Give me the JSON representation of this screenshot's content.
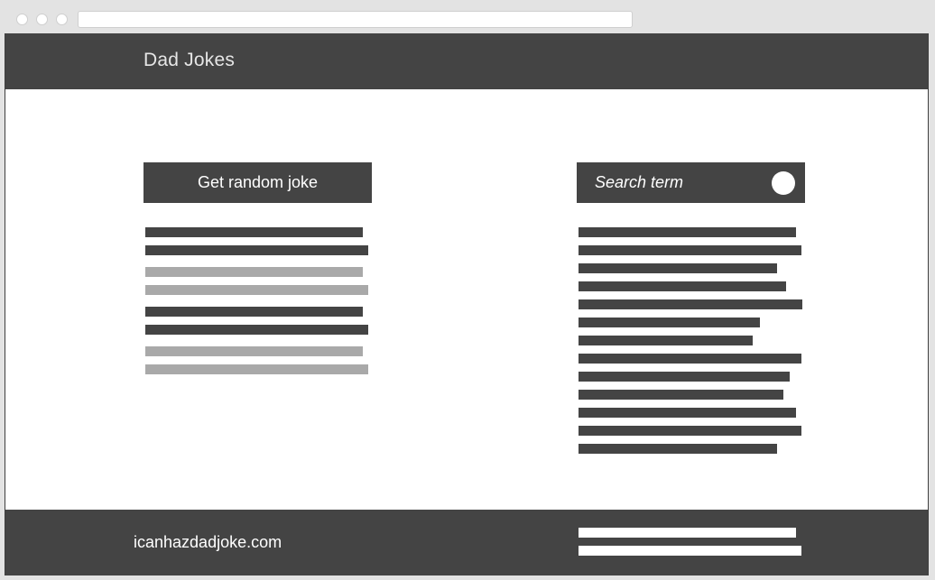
{
  "header": {
    "title": "Dad Jokes"
  },
  "random_joke": {
    "button_label": "Get random joke"
  },
  "search": {
    "placeholder": "Search term"
  },
  "footer": {
    "link_text": "icanhazdadjoke.com"
  },
  "colors": {
    "dark": "#444444",
    "placeholder_gray": "#a9a9a9",
    "background": "#ffffff"
  }
}
